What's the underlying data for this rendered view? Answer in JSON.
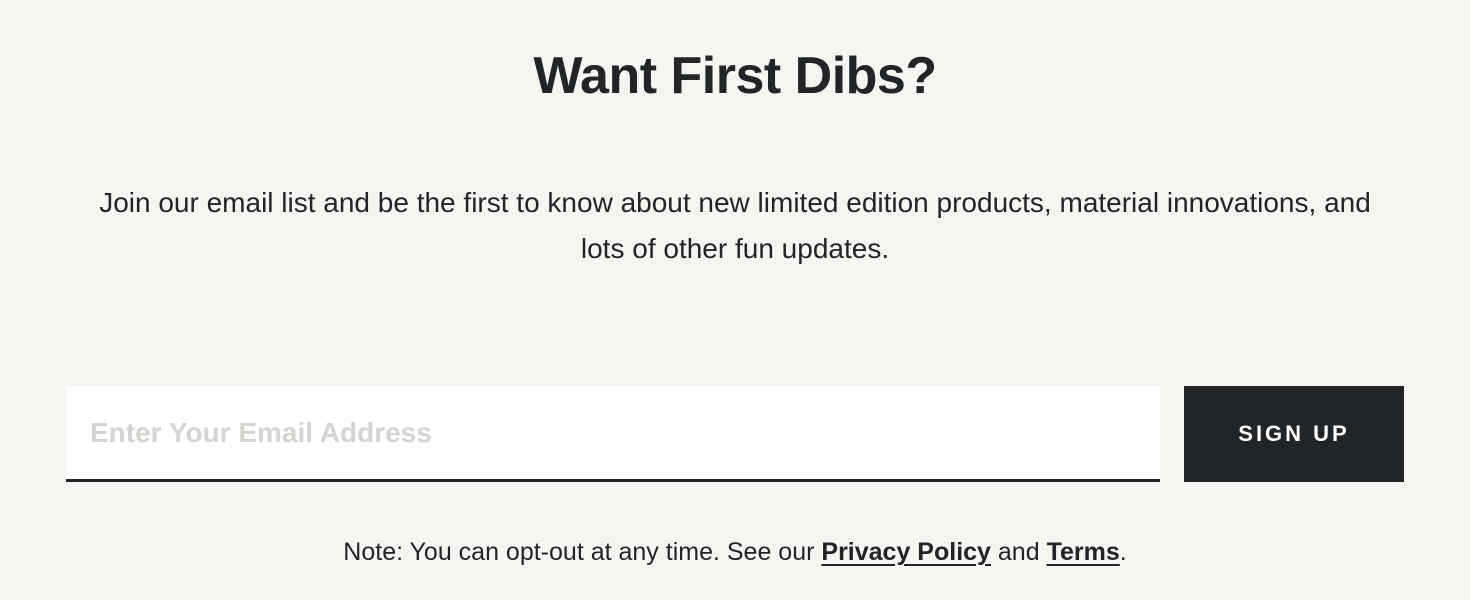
{
  "heading": "Want First Dibs?",
  "description": "Join our email list and be the first to know about new limited edition products, material innovations, and lots of other fun updates.",
  "form": {
    "email_placeholder": "Enter Your Email Address",
    "submit_label": "SIGN UP"
  },
  "note": {
    "prefix": "Note: You can opt-out at any time. See our ",
    "privacy_label": "Privacy Policy",
    "connector": " and ",
    "terms_label": "Terms",
    "suffix": "."
  }
}
